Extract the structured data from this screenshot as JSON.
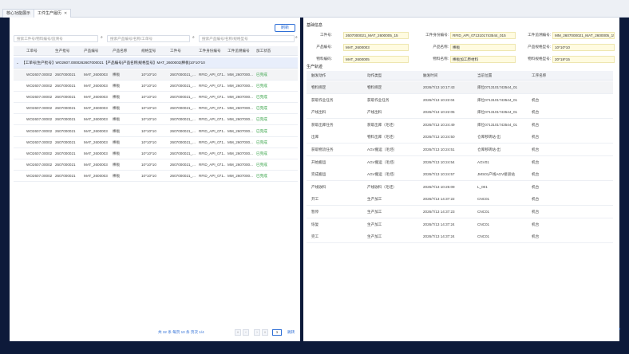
{
  "tabs": [
    {
      "label": "核心功能展示",
      "active": false,
      "closable": false
    },
    {
      "label": "工件生产履历",
      "active": true,
      "closable": true
    }
  ],
  "toolbar": {
    "refresh_label": "刷新"
  },
  "search": {
    "ph_workorder": "搜索工件号/物料编号/追溯号",
    "ph_product": "搜索产品编号/名称/工单号",
    "ph_rfid": "搜索产品编号/名称/规格型号"
  },
  "table": {
    "headers": [
      "工单号",
      "生产批号",
      "产品编号",
      "产品名称",
      "规格型号",
      "工件号",
      "工件身份编号",
      "工件追溯编号",
      "加工状态"
    ],
    "group_label": "【工单号|生产批号】WO2607.0000262607000021【产品编号|产品名称|规格型号】MAT_2600003|棒板|10*10*10",
    "rows": [
      {
        "wo": "WO2607.00002",
        "batch": "2607000021",
        "prod": "MAT_2600003",
        "name": "棒板",
        "spec": "10*10*10",
        "piece": "2607000021_...",
        "rfid": "RFID_API_071...",
        "trace": "MM_2607000...",
        "status": "已完成"
      },
      {
        "wo": "WO2607.00002",
        "batch": "2607000021",
        "prod": "MAT_2600003",
        "name": "棒板",
        "spec": "10*10*10",
        "piece": "2607000021_...",
        "rfid": "RFID_API_071...",
        "trace": "MM_2607000...",
        "status": "已完成"
      },
      {
        "wo": "WO2607.00002",
        "batch": "2607000021",
        "prod": "MAT_2600003",
        "name": "棒板",
        "spec": "10*10*10",
        "piece": "2607000021_...",
        "rfid": "RFID_API_071...",
        "trace": "MM_2607000...",
        "status": "已完成"
      },
      {
        "wo": "WO2607.00002",
        "batch": "2607000021",
        "prod": "MAT_2600003",
        "name": "棒板",
        "spec": "10*10*10",
        "piece": "2607000021_...",
        "rfid": "RFID_API_071...",
        "trace": "MM_2607000...",
        "status": "已完成"
      },
      {
        "wo": "WO2607.00002",
        "batch": "2607000021",
        "prod": "MAT_2600003",
        "name": "棒板",
        "spec": "10*10*10",
        "piece": "2607000021_...",
        "rfid": "RFID_API_071...",
        "trace": "MM_2607000...",
        "status": "已完成"
      },
      {
        "wo": "WO2607.00002",
        "batch": "2607000021",
        "prod": "MAT_2600003",
        "name": "棒板",
        "spec": "10*10*10",
        "piece": "2607000021_...",
        "rfid": "RFID_API_071...",
        "trace": "MM_2607000...",
        "status": "已完成"
      },
      {
        "wo": "WO2607.00002",
        "batch": "2607000021",
        "prod": "MAT_2600003",
        "name": "棒板",
        "spec": "10*10*10",
        "piece": "2607000021_...",
        "rfid": "RFID_API_071...",
        "trace": "MM_2607000...",
        "status": "已完成"
      },
      {
        "wo": "WO2607.00002",
        "batch": "2607000021",
        "prod": "MAT_2600003",
        "name": "棒板",
        "spec": "10*10*10",
        "piece": "2607000021_...",
        "rfid": "RFID_API_071...",
        "trace": "MM_2607000...",
        "status": "已完成"
      },
      {
        "wo": "WO2607.00002",
        "batch": "2607000021",
        "prod": "MAT_2600003",
        "name": "棒板",
        "spec": "10*10*10",
        "piece": "2607000021_...",
        "rfid": "RFID_API_071...",
        "trace": "MM_2607000...",
        "status": "已完成"
      },
      {
        "wo": "WO2607.00002",
        "batch": "2607000021",
        "prod": "MAT_2600003",
        "name": "棒板",
        "spec": "10*10*10",
        "piece": "2607000021_...",
        "rfid": "RFID_API_071...",
        "trace": "MM_2607000...",
        "status": "已完成"
      }
    ]
  },
  "pager": {
    "summary": "共 32 条  每页 10 条  页次 1/4",
    "page": "1",
    "go_label": "跳转",
    "prev": "‹",
    "next": "›",
    "first": "«",
    "last": "»"
  },
  "detail": {
    "basic_title": "基础信息",
    "fields": [
      {
        "label": "工件号:",
        "value": "2607000021_MAT_2600005_15"
      },
      {
        "label": "工件身份编号:",
        "value": "RFID_API_0713101743544_015"
      },
      {
        "label": "工件追溯编号:",
        "value": "MM_2607000021_MAT_2600005_15"
      },
      {
        "label": "产品编号:",
        "value": "MAT_2600003"
      },
      {
        "label": "产品名称:",
        "value": "棒板"
      },
      {
        "label": "产品规格型号:",
        "value": "10*10*10"
      },
      {
        "label": "物料编码:",
        "value": "MAT_2600005"
      },
      {
        "label": "物料名称:",
        "value": "棒板加工原材料"
      },
      {
        "label": "物料规格型号:",
        "value": "20*18*15"
      }
    ],
    "track_title": "生产轨迹",
    "track_headers": [
      "触发动作",
      "动作类型",
      "触发时间",
      "当前位置",
      "工序名称"
    ],
    "track_rows": [
      {
        "action": "物料绑定",
        "type": "物料绑定",
        "time": "2026/7/13 10:17:43",
        "loc": "库位07131017435​44_01",
        "proc": ""
      },
      {
        "action": "获取作业任务",
        "type": "获取作业任务",
        "time": "2026/7/13 10:22:04",
        "loc": "库位07131017435​44_01",
        "proc": "机台"
      },
      {
        "action": "产线出料",
        "type": "产线出料",
        "time": "2026/7/13 10:22:05",
        "loc": "库位07131017435​44_01",
        "proc": "机台"
      },
      {
        "action": "获取出库任务",
        "type": "获取出库（毛坯）",
        "time": "2026/7/13 10:24:49",
        "loc": "库位07131017435​44_01",
        "proc": "机台"
      },
      {
        "action": "出库",
        "type": "物料出库（毛坯）",
        "time": "2026/7/13 10:24:50",
        "loc": "仓库移转站-出",
        "proc": "机台"
      },
      {
        "action": "获取物流任务",
        "type": "AGV搬运（毛坯）",
        "time": "2026/7/13 10:24:51",
        "loc": "仓库移转站-出",
        "proc": "机台"
      },
      {
        "action": "开始搬运",
        "type": "AGV搬运（毛坯）",
        "time": "2026/7/13 10:24:54",
        "loc": "AGV01",
        "proc": "机台"
      },
      {
        "action": "完成搬运",
        "type": "AGV搬运（毛坯）",
        "time": "2026/7/13 10:24:57",
        "loc": "JMS01产线AGV接驳站",
        "proc": "机台"
      },
      {
        "action": "产线收料",
        "type": "产线收料（毛坯）",
        "time": "2026/7/13 10:25:09",
        "loc": "L_001",
        "proc": "机台"
      },
      {
        "action": "开工",
        "type": "生产加工",
        "time": "2026/7/13 14:37:22",
        "loc": "CNC01",
        "proc": "机台"
      },
      {
        "action": "暂停",
        "type": "生产加工",
        "time": "2026/7/13 14:37:23",
        "loc": "CNC01",
        "proc": "机台"
      },
      {
        "action": "恢复",
        "type": "生产加工",
        "time": "2026/7/13 14:37:24",
        "loc": "CNC01",
        "proc": "机台"
      },
      {
        "action": "完工",
        "type": "生产加工",
        "time": "2026/7/13 14:37:24",
        "loc": "CNC01",
        "proc": "机台"
      }
    ]
  },
  "icons": {
    "search": "magnifier-icon",
    "close": "close-icon",
    "caret": "caret-down-icon"
  },
  "colors": {
    "accent": "#2f6fd6",
    "done": "#2a9d3c",
    "highlight": "#fffbe0",
    "frame": "#0d1a3a"
  }
}
